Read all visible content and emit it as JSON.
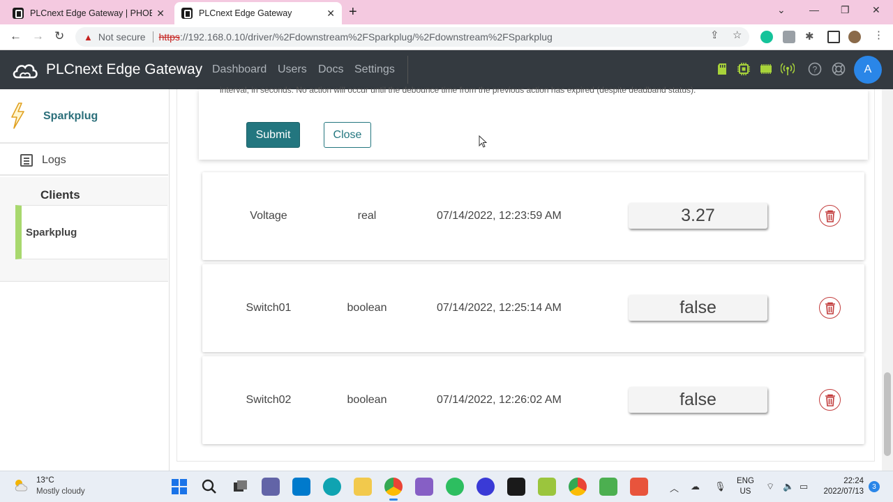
{
  "browser": {
    "tabs": [
      {
        "title": "PLCnext Edge Gateway | PHOENIX",
        "active": false
      },
      {
        "title": "PLCnext Edge Gateway",
        "active": true
      }
    ],
    "security_label": "Not secure",
    "url_scheme": "https",
    "url_rest": "://192.168.0.10/driver/%2Fdownstream%2FSparkplug/%2Fdownstream%2FSparkplug"
  },
  "navbar": {
    "brand": "PLCnext Edge Gateway",
    "links": [
      "Dashboard",
      "Users",
      "Docs",
      "Settings"
    ],
    "avatar_initial": "A",
    "accent": "#a8d33a"
  },
  "sidebar": {
    "sparkplug_label": "Sparkplug",
    "logs_label": "Logs",
    "clients_title": "Clients",
    "client_item": "Sparkplug"
  },
  "form": {
    "help_text": "interval, in seconds. No action will occur until the debounce time from the previous action has expired (despite deadband status).",
    "submit_label": "Submit",
    "close_label": "Close",
    "primary_color": "#23767f"
  },
  "tags": [
    {
      "name": "Voltage",
      "type": "real",
      "timestamp": "07/14/2022, 12:23:59 AM",
      "value": "3.27"
    },
    {
      "name": "Switch01",
      "type": "boolean",
      "timestamp": "07/14/2022, 12:25:14 AM",
      "value": "false"
    },
    {
      "name": "Switch02",
      "type": "boolean",
      "timestamp": "07/14/2022, 12:26:02 AM",
      "value": "false"
    }
  ],
  "taskbar": {
    "weather_temp": "13°C",
    "weather_desc": "Mostly cloudy",
    "lang_line1": "ENG",
    "lang_line2": "US",
    "time": "22:24",
    "date": "2022/07/13",
    "notifications": "3"
  }
}
